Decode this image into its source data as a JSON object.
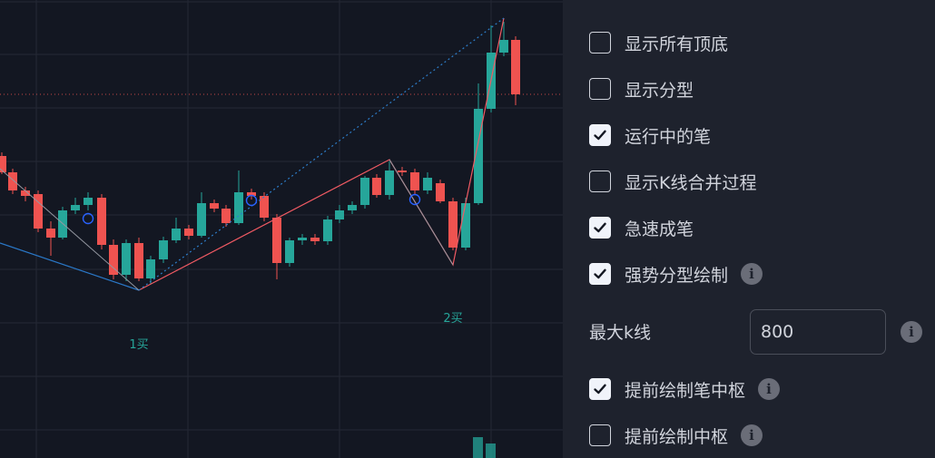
{
  "chart_data": {
    "type": "candlestick",
    "annotations": [
      {
        "label": "1买"
      },
      {
        "label": "2买"
      }
    ],
    "colors": {
      "up": "#26a69a",
      "down": "#ef5350",
      "stroke_line": "#f05a63",
      "dotted_line": "#2d7ecb",
      "blue_line": "#2a78c8",
      "gray_line": "#9598a1",
      "marker": "#2962ff",
      "label": "#26a69a",
      "grid": "#242935",
      "price_line": "#ef5350"
    }
  },
  "settings": {
    "options": [
      {
        "label": "显示所有顶底",
        "checked": false,
        "info": false
      },
      {
        "label": "显示分型",
        "checked": false,
        "info": false
      },
      {
        "label": "运行中的笔",
        "checked": true,
        "info": false
      },
      {
        "label": "显示K线合并过程",
        "checked": false,
        "info": false
      },
      {
        "label": "急速成笔",
        "checked": true,
        "info": false
      },
      {
        "label": "强势分型绘制",
        "checked": true,
        "info": true
      },
      {
        "label": "提前绘制笔中枢",
        "checked": true,
        "info": true
      },
      {
        "label": "提前绘制中枢",
        "checked": false,
        "info": true
      }
    ],
    "max_k": {
      "label": "最大k线",
      "value": "800"
    },
    "info_glyph": "i"
  }
}
